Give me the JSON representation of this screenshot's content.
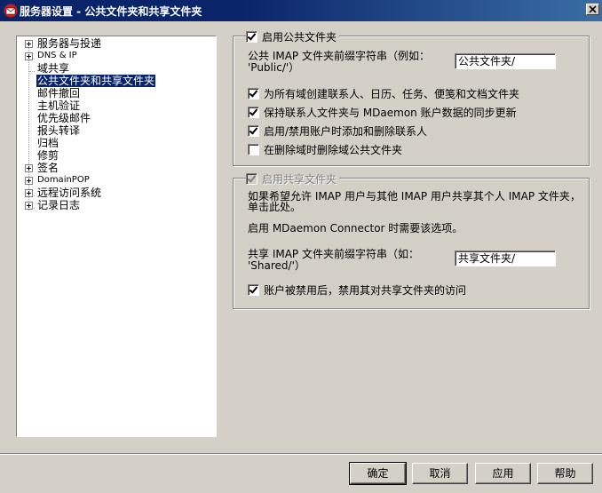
{
  "window": {
    "title": "服务器设置 - 公共文件夹和共享文件夹",
    "app_icon": "envelope-icon",
    "close_icon": "close-icon"
  },
  "sidebar": {
    "items": [
      {
        "label": "服务器与投递",
        "expandable": true
      },
      {
        "label": "DNS & IP",
        "expandable": true
      },
      {
        "label": "域共享",
        "expandable": false
      },
      {
        "label": "公共文件夹和共享文件夹",
        "expandable": false,
        "selected": true
      },
      {
        "label": "邮件撤回",
        "expandable": false
      },
      {
        "label": "主机验证",
        "expandable": false
      },
      {
        "label": "优先级邮件",
        "expandable": false
      },
      {
        "label": "报头转译",
        "expandable": false
      },
      {
        "label": "归档",
        "expandable": false
      },
      {
        "label": "修剪",
        "expandable": false
      },
      {
        "label": "签名",
        "expandable": true
      },
      {
        "label": "DomainPOP",
        "expandable": true
      },
      {
        "label": "远程访问系统",
        "expandable": true
      },
      {
        "label": "记录日志",
        "expandable": true
      }
    ]
  },
  "public_folders": {
    "enable_label": "启用公共文件夹",
    "enabled": true,
    "prefix_label_line1": "公共 IMAP 文件夹前缀字符串（例如：",
    "prefix_label_line2": "'Public/'）",
    "prefix_value": "公共文件夹/",
    "options": [
      {
        "label": "为所有域创建联系人、日历、任务、便笺和文档文件夹",
        "checked": true
      },
      {
        "label": "保持联系人文件夹与 MDaemon 账户数据的同步更新",
        "checked": true
      },
      {
        "label": "启用/禁用账户时添加和删除联系人",
        "checked": true
      },
      {
        "label": "在删除域时删除域公共文件夹",
        "checked": false
      }
    ]
  },
  "shared_folders": {
    "enable_label": "启用共享文件夹",
    "enabled": true,
    "disabled": true,
    "description_line1": "如果希望允许 IMAP 用户与其他 IMAP 用户共享其个人 IMAP 文件夹，",
    "description_line2": "单击此处。",
    "connector_note": "启用 MDaemon Connector 时需要该选项。",
    "prefix_label_line1": "共享 IMAP 文件夹前缀字符串（如：",
    "prefix_label_line2": "'Shared/'）",
    "prefix_value": "共享文件夹/",
    "disable_access_label": "账户被禁用后，禁用其对共享文件夹的访问",
    "disable_access_checked": true
  },
  "buttons": {
    "ok": "确定",
    "cancel": "取消",
    "apply": "应用",
    "help": "帮助"
  },
  "colors": {
    "titlebar": "#0a246a",
    "selection": "#0a246a",
    "face": "#d4d0c8"
  }
}
